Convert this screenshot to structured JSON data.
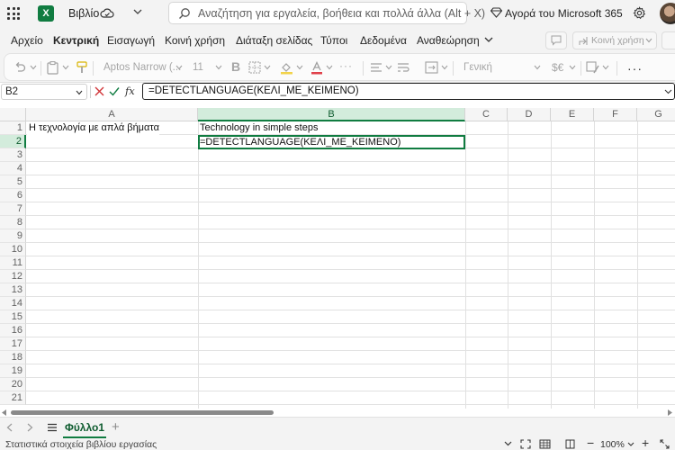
{
  "titlebar": {
    "app_letter": "X",
    "doc_name": "Βιβλίο",
    "search_placeholder": "Αναζήτηση για εργαλεία, βοήθεια και πολλά άλλα (Alt + X)",
    "buy_label": "Αγορά του Microsoft 365"
  },
  "ribbon": {
    "tabs": [
      "Αρχείο",
      "Κεντρική",
      "Εισαγωγή",
      "Κοινή χρήση",
      "Διάταξη σελίδας",
      "Τύποι",
      "Δεδομένα",
      "Αναθεώρηση"
    ],
    "active_tab": "Κεντρική",
    "share_label": "Κοινή χρήση"
  },
  "toolbar": {
    "font_name": "Aptos Narrow (...",
    "font_size": "11",
    "bold_label": "B",
    "number_format": "Γενική",
    "currency_label": "$€",
    "more_label": "···"
  },
  "formula_bar": {
    "name_box": "B2",
    "fx_label": "fx",
    "formula": "=DETECTLANGUAGE(ΚΕΛΙ_ΜΕ_ΚΕΙΜΕΝΟ)"
  },
  "grid": {
    "columns": [
      "A",
      "B",
      "C",
      "D",
      "E",
      "F",
      "G"
    ],
    "rows": [
      "1",
      "2",
      "3",
      "4",
      "5",
      "6",
      "7",
      "8",
      "9",
      "10",
      "11",
      "12",
      "13",
      "14",
      "15",
      "16",
      "17",
      "18",
      "19",
      "20",
      "21"
    ],
    "selected_column": "B",
    "selected_row": "2",
    "cells": {
      "A1": "Η τεχνολογία με απλά βήματα",
      "B1": "Technology in simple steps",
      "B2": "=DETECTLANGUAGE(ΚΕΛΙ_ΜΕ_ΚΕΙΜΕΝΟ)"
    }
  },
  "sheets": {
    "tabs": [
      "Φύλλο1"
    ],
    "active": "Φύλλο1"
  },
  "statusbar": {
    "text": "Στατιστικά στοιχεία βιβλίου εργασίας",
    "zoom": "100%"
  },
  "colors": {
    "accent": "#107c41",
    "header_selected": "#d3ecdc"
  }
}
